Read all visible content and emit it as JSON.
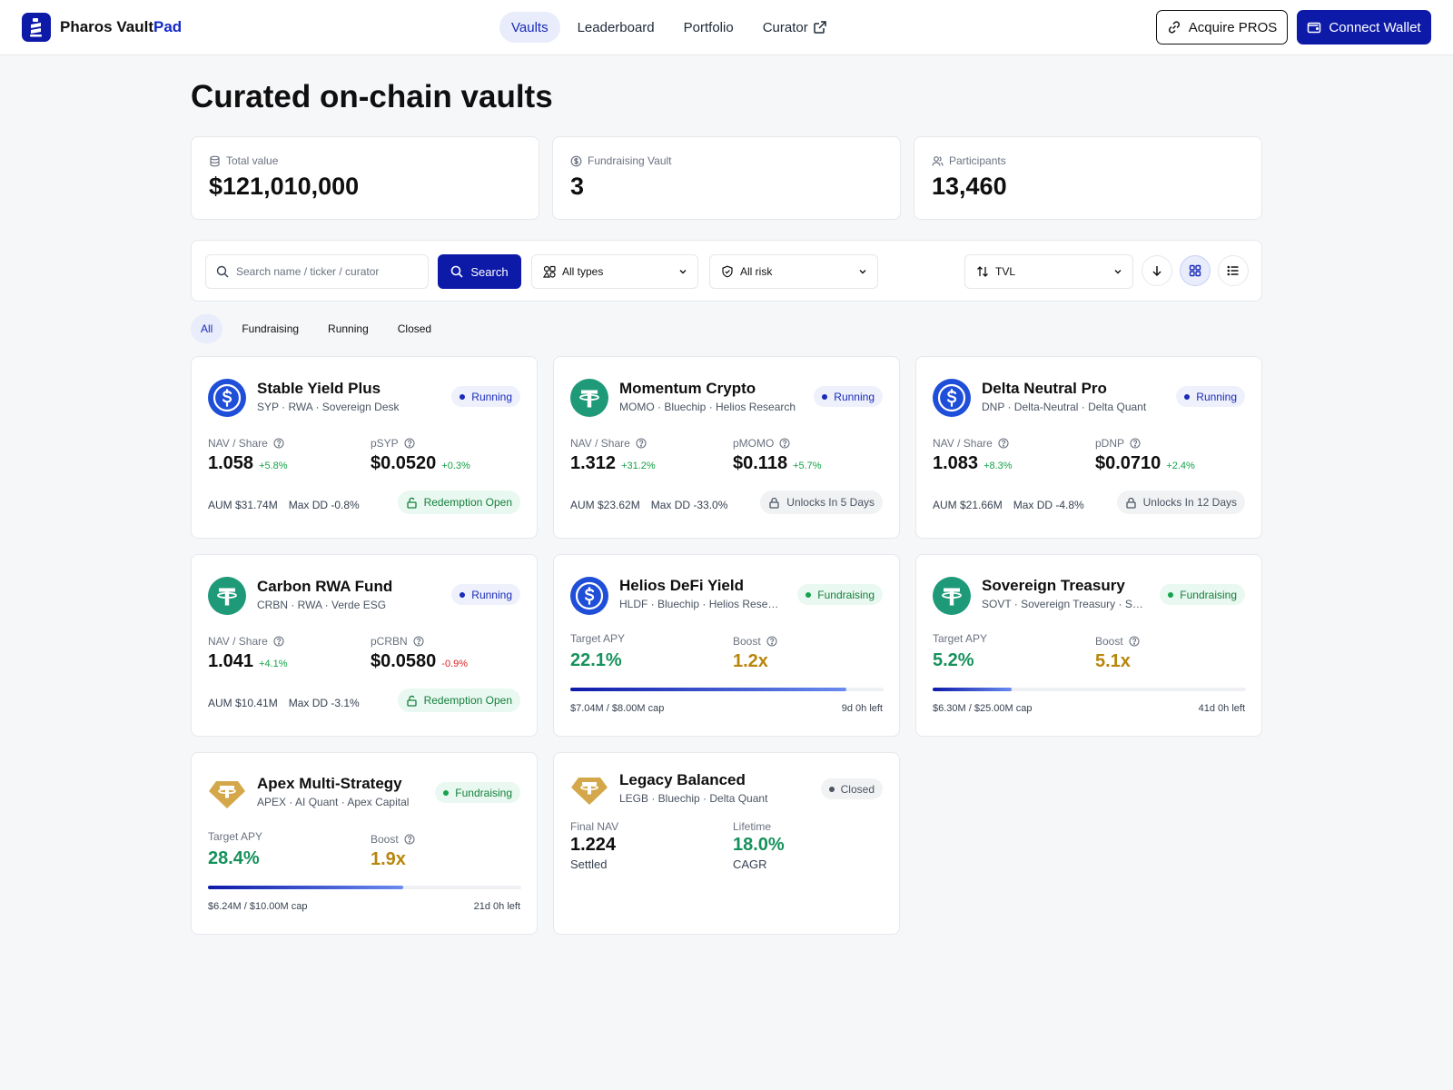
{
  "header": {
    "brand_main": "Pharos Vault",
    "brand_accent": "Pad",
    "nav": [
      {
        "label": "Vaults"
      },
      {
        "label": "Leaderboard"
      },
      {
        "label": "Portfolio"
      },
      {
        "label": "Curator"
      }
    ],
    "acquire_label": "Acquire PROS",
    "connect_label": "Connect Wallet"
  },
  "page": {
    "title": "Curated on-chain vaults"
  },
  "stats": [
    {
      "label": "Total value",
      "value": "$121,010,000"
    },
    {
      "label": "Fundraising Vault",
      "value": "3"
    },
    {
      "label": "Participants",
      "value": "13,460"
    }
  ],
  "toolbar": {
    "search_placeholder": "Search name / ticker / curator",
    "search_label": "Search",
    "type_select": "All types",
    "risk_select": "All risk",
    "sort_select": "TVL"
  },
  "tabs": [
    {
      "label": "All"
    },
    {
      "label": "Fundraising"
    },
    {
      "label": "Running"
    },
    {
      "label": "Closed"
    }
  ],
  "vaults": [
    {
      "name": "Stable Yield Plus",
      "sub": "SYP · RWA · Sovereign Desk",
      "status": "Running",
      "m1_label": "NAV / Share",
      "m1_value": "1.058",
      "m1_chg": "+5.8%",
      "m2_label": "pSYP",
      "m2_value": "$0.0520",
      "m2_chg": "+0.3%",
      "aum": "AUM $31.74M",
      "dd": "Max DD -0.8%",
      "pill": "Redemption Open"
    },
    {
      "name": "Momentum Crypto",
      "sub": "MOMO · Bluechip · Helios Research",
      "status": "Running",
      "m1_label": "NAV / Share",
      "m1_value": "1.312",
      "m1_chg": "+31.2%",
      "m2_label": "pMOMO",
      "m2_value": "$0.118",
      "m2_chg": "+5.7%",
      "aum": "AUM $23.62M",
      "dd": "Max DD -33.0%",
      "pill": "Unlocks In 5 Days"
    },
    {
      "name": "Delta Neutral Pro",
      "sub": "DNP · Delta-Neutral · Delta Quant",
      "status": "Running",
      "m1_label": "NAV / Share",
      "m1_value": "1.083",
      "m1_chg": "+8.3%",
      "m2_label": "pDNP",
      "m2_value": "$0.0710",
      "m2_chg": "+2.4%",
      "aum": "AUM $21.66M",
      "dd": "Max DD -4.8%",
      "pill": "Unlocks In 12 Days"
    },
    {
      "name": "Carbon RWA Fund",
      "sub": "CRBN · RWA · Verde ESG",
      "status": "Running",
      "m1_label": "NAV / Share",
      "m1_value": "1.041",
      "m1_chg": "+4.1%",
      "m2_label": "pCRBN",
      "m2_value": "$0.0580",
      "m2_chg": "-0.9%",
      "aum": "AUM $10.41M",
      "dd": "Max DD -3.1%",
      "pill": "Redemption Open"
    },
    {
      "name": "Helios DeFi Yield",
      "sub": "HLDF · Bluechip · Helios Research",
      "status": "Fundraising",
      "apy_label": "Target APY",
      "apy": "22.1%",
      "boost_label": "Boost",
      "boost": "1.2x",
      "raised": "$7.04M / $8.00M cap",
      "left": "9d 0h left",
      "progress": 0.88
    },
    {
      "name": "Sovereign Treasury",
      "sub": "SOVT · Sovereign Treasury · Sovereign Desk",
      "status": "Fundraising",
      "apy_label": "Target APY",
      "apy": "5.2%",
      "boost_label": "Boost",
      "boost": "5.1x",
      "raised": "$6.30M / $25.00M cap",
      "left": "41d 0h left",
      "progress": 0.252
    },
    {
      "name": "Apex Multi-Strategy",
      "sub": "APEX · AI Quant · Apex Capital",
      "status": "Fundraising",
      "apy_label": "Target APY",
      "apy": "28.4%",
      "boost_label": "Boost",
      "boost": "1.9x",
      "raised": "$6.24M / $10.00M cap",
      "left": "21d 0h left",
      "progress": 0.624
    },
    {
      "name": "Legacy Balanced",
      "sub": "LEGB · Bluechip · Delta Quant",
      "status": "Closed",
      "nav_label": "Final NAV",
      "nav": "1.224",
      "nav_note": "Settled",
      "life_label": "Lifetime",
      "life": "18.0%",
      "life_note": "CAGR"
    }
  ],
  "colors": {
    "brand": "#0d1aa8",
    "green": "#15925c",
    "gold": "#b8860b",
    "usdc": "#1f4ed8",
    "usdt": "#1f9a78"
  }
}
